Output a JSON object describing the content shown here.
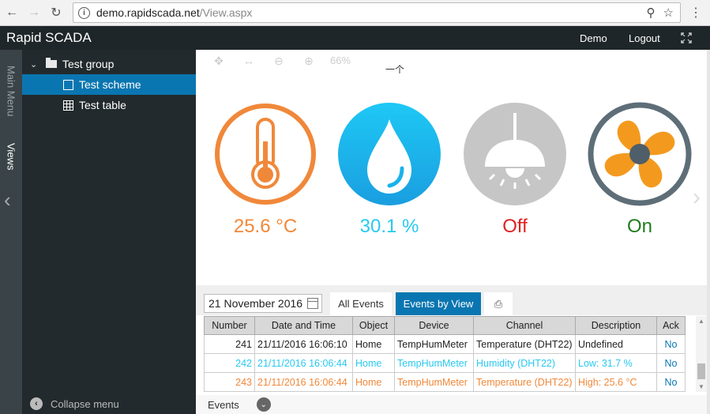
{
  "browser": {
    "url_host": "demo.rapidscada.net",
    "url_path": "/View.aspx"
  },
  "header": {
    "title": "Rapid SCADA",
    "user": "Demo",
    "logout": "Logout"
  },
  "side_tabs": {
    "main_menu": "Main Menu",
    "views": "Views"
  },
  "tree": {
    "items": [
      {
        "label": "Test group"
      },
      {
        "label": "Test scheme"
      },
      {
        "label": "Test table"
      }
    ],
    "collapse_label": "Collapse menu"
  },
  "scheme": {
    "zoom": "66%",
    "mark": "一个",
    "widgets": [
      {
        "icon": "thermometer-icon",
        "value": "25.6 °C",
        "color": "#f0883a"
      },
      {
        "icon": "water-drop-icon",
        "value": "30.1 %",
        "color": "#29c9f0"
      },
      {
        "icon": "lamp-icon",
        "value": "Off",
        "color": "#e02020"
      },
      {
        "icon": "fan-icon",
        "value": "On",
        "color": "#1e7d1e"
      }
    ]
  },
  "events": {
    "date": "21 November 2016",
    "tab_all": "All Events",
    "tab_by_view": "Events by View",
    "columns": [
      "Number",
      "Date and Time",
      "Object",
      "Device",
      "Channel",
      "Description",
      "Ack"
    ],
    "rows": [
      {
        "cells": [
          "241",
          "21/11/2016 16:06:10",
          "Home",
          "TempHumMeter",
          "Temperature (DHT22)",
          "Undefined",
          "No"
        ],
        "color": "#222222"
      },
      {
        "cells": [
          "242",
          "21/11/2016 16:06:44",
          "Home",
          "TempHumMeter",
          "Humidity (DHT22)",
          "Low: 31.7 %",
          "No"
        ],
        "color": "#29c9f0"
      },
      {
        "cells": [
          "243",
          "21/11/2016 16:06:44",
          "Home",
          "TempHumMeter",
          "Temperature (DHT22)",
          "High: 25.6 °C",
          "No"
        ],
        "color": "#f0883a"
      }
    ],
    "footer_label": "Events"
  },
  "colors": {
    "accent": "#0a76b1",
    "header_bg": "#1f2629",
    "tree_bg": "#222a2d"
  }
}
